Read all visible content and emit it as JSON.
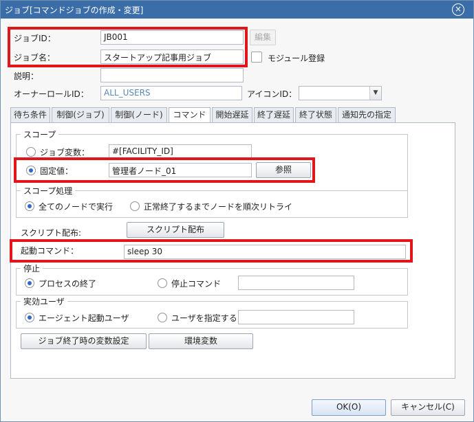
{
  "window": {
    "title": "ジョブ[コマンドジョブの作成・変更]",
    "close_icon": "×"
  },
  "form": {
    "job_id_label": "ジョブID：",
    "job_id_value": "JB001",
    "edit_button": "編集",
    "job_name_label": "ジョブ名：",
    "job_name_value": "スタートアップ記事用ジョブ",
    "module_label": "モジュール登録",
    "description_label": "説明：",
    "description_value": "",
    "owner_role_label": "オーナーロールID：",
    "owner_role_value": "ALL_USERS",
    "icon_id_label": "アイコンID：",
    "icon_id_value": ""
  },
  "tabs": [
    "待ち条件",
    "制御(ジョブ)",
    "制御(ノード)",
    "コマンド",
    "開始遅延",
    "終了遅延",
    "終了状態",
    "通知先の指定"
  ],
  "active_tab": "コマンド",
  "scope": {
    "legend": "スコープ",
    "job_var_label": "ジョブ変数：",
    "job_var_value": "#[FACILITY_ID]",
    "fixed_label": "固定値：",
    "fixed_value": "管理者ノード_01",
    "browse_button": "参照"
  },
  "scope_processing": {
    "legend": "スコープ処理",
    "all_nodes": "全てのノードで実行",
    "retry_nodes": "正常終了するまでノードを順次リトライ"
  },
  "script": {
    "label": "スクリプト配布:",
    "button": "スクリプト配布"
  },
  "start_command": {
    "label": "起動コマンド：",
    "value": "sleep 30"
  },
  "stop": {
    "legend": "停止",
    "process_end": "プロセスの終了",
    "stop_command": "停止コマンド",
    "stop_command_value": ""
  },
  "effective_user": {
    "legend": "実効ユーザ",
    "agent_user": "エージェント起動ユーザ",
    "specify_user": "ユーザを指定する",
    "user_value": ""
  },
  "bottom_buttons": {
    "var_settings": "ジョブ終了時の変数設定",
    "env_vars": "環境変数"
  },
  "dialog_buttons": {
    "ok": "OK(O)",
    "cancel": "キャンセル(C)"
  },
  "colors": {
    "title_bar": "#3b6ea8",
    "highlight": "#e0161b",
    "radio_on": "#2f68c4"
  }
}
